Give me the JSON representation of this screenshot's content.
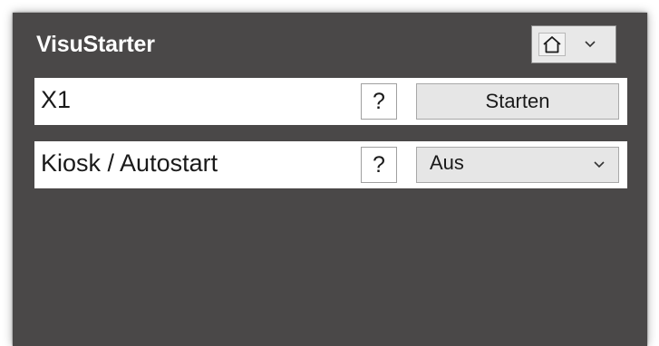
{
  "window": {
    "title": "VisuStarter",
    "home_dropdown": {
      "icon": "home-icon",
      "expand_icon": "chevron-down-icon"
    }
  },
  "rows": [
    {
      "label": "X1",
      "help_label": "?",
      "action_label": "Starten"
    },
    {
      "label": "Kiosk / Autostart",
      "help_label": "?",
      "select_value": "Aus",
      "expand_icon": "chevron-down-icon"
    }
  ],
  "colors": {
    "window_background": "#4a4848",
    "row_background": "#ffffff",
    "button_background": "#e6e6e6",
    "title_text": "#ffffff"
  }
}
